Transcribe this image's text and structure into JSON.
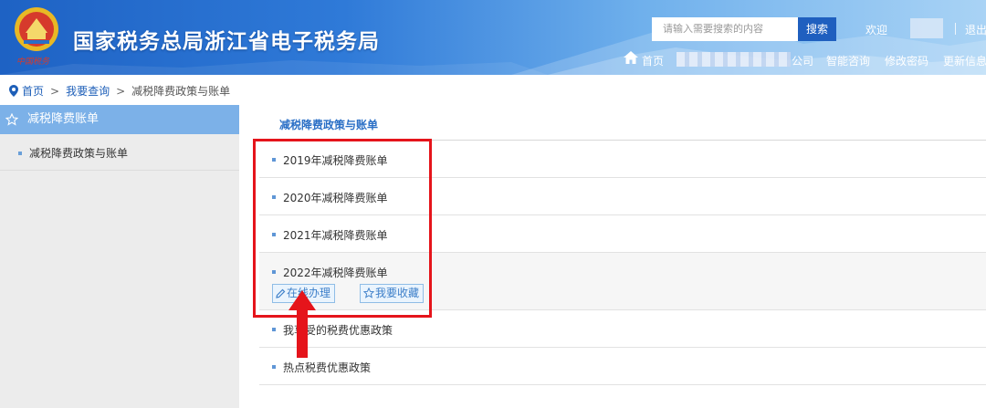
{
  "header": {
    "title": "国家税务总局浙江省电子税务局",
    "seal_text": "中国税务",
    "search": {
      "placeholder": "请输入需要搜索的内容",
      "button": "搜索"
    },
    "welcome": "欢迎",
    "logout": "退出",
    "nav": {
      "home": "首页",
      "company_suffix": "公司",
      "smart_consult": "智能咨询",
      "change_password": "修改密码",
      "update_info": "更新信息"
    }
  },
  "breadcrumb": {
    "home": "首页",
    "query": "我要查询",
    "current": "减税降费政策与账单",
    "separator": ">"
  },
  "sidebar": {
    "heading": "减税降费账单",
    "items": [
      {
        "label": "减税降费政策与账单"
      }
    ]
  },
  "main": {
    "title": "减税降费政策与账单",
    "rows": [
      {
        "label": "2019年减税降费账单"
      },
      {
        "label": "2020年减税降费账单"
      },
      {
        "label": "2021年减税降费账单"
      },
      {
        "label": "2022年减税降费账单",
        "actions": {
          "online": "在线办理",
          "favorite": "我要收藏"
        }
      },
      {
        "label": "我享受的税费优惠政策"
      },
      {
        "label": "热点税费优惠政策"
      }
    ]
  },
  "colors": {
    "header_blue": "#1e62c4",
    "sidebar_head": "#7cb1e8",
    "link_blue": "#1e5fb8",
    "annotation_red": "#e5141b"
  }
}
